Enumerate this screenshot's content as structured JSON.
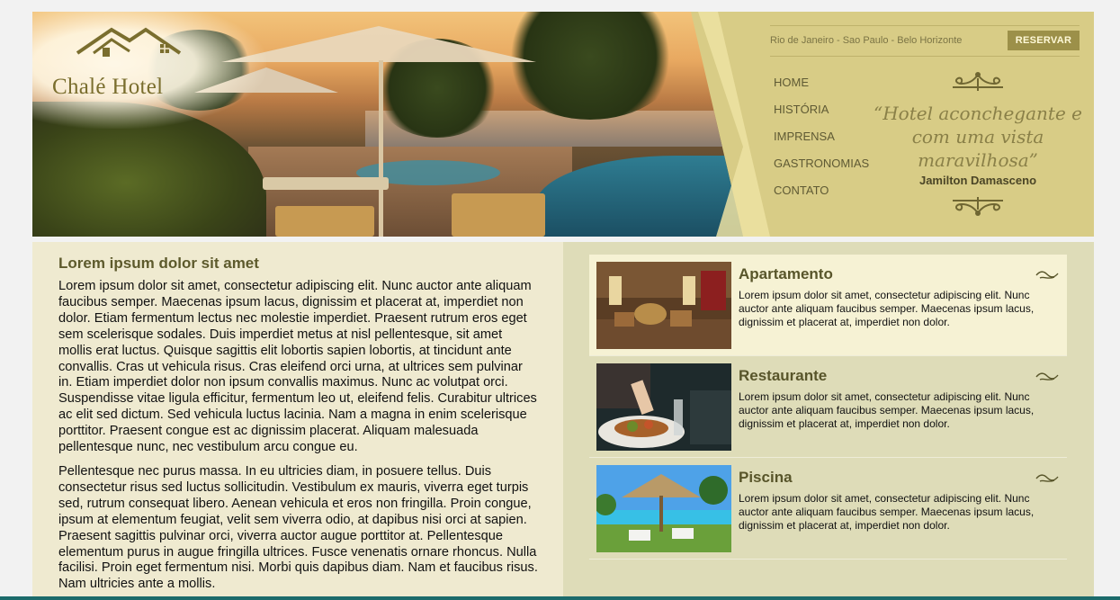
{
  "brand": {
    "name": "Chalé Hotel"
  },
  "header": {
    "cities": "Rio de Janeiro - Sao Paulo - Belo Horizonte",
    "reserve_label": "RESERVAR",
    "nav": [
      "HOME",
      "HISTÓRIA",
      "IMPRENSA",
      "GASTRONOMIAS",
      "CONTATO"
    ],
    "quote": "“Hotel aconchegante e com uma vista maravilhosa”",
    "quote_author": "Jamilton Damasceno"
  },
  "main": {
    "title": "Lorem ipsum dolor sit amet",
    "paragraphs": [
      "Lorem ipsum dolor sit amet, consectetur adipiscing elit. Nunc auctor ante aliquam faucibus semper. Maecenas ipsum lacus, dignissim et placerat at, imperdiet non dolor. Etiam fermentum lectus nec molestie imperdiet. Praesent rutrum eros eget sem scelerisque sodales. Duis imperdiet metus at nisl pellentesque, sit amet mollis erat luctus. Quisque sagittis elit lobortis sapien lobortis, at tincidunt ante convallis. Cras ut vehicula risus. Cras eleifend orci urna, at ultrices sem pulvinar in. Etiam imperdiet dolor non ipsum convallis maximus. Nunc ac volutpat orci. Suspendisse vitae ligula efficitur, fermentum leo ut, eleifend felis. Curabitur ultrices ac elit sed dictum. Sed vehicula luctus lacinia. Nam a magna in enim scelerisque porttitor. Praesent congue est ac dignissim placerat. Aliquam malesuada pellentesque nunc, nec vestibulum arcu congue eu.",
      "Pellentesque nec purus massa. In eu ultricies diam, in posuere tellus. Duis consectetur risus sed luctus sollicitudin. Vestibulum ex mauris, viverra eget turpis sed, rutrum consequat libero. Aenean vehicula et eros non fringilla. Proin congue, ipsum at elementum feugiat, velit sem viverra odio, at dapibus nisi orci at sapien. Praesent sagittis pulvinar orci, viverra auctor augue porttitor at. Pellentesque elementum purus in augue fringilla ultrices. Fusce venenatis ornare rhoncus. Nulla facilisi. Proin eget fermentum nisi. Morbi quis dapibus diam. Nam et faucibus risus. Nam ultricies ante a mollis."
    ]
  },
  "features": [
    {
      "title": "Apartamento",
      "text": "Lorem ipsum dolor sit amet, consectetur adipiscing elit. Nunc auctor ante aliquam faucibus semper. Maecenas ipsum lacus, dignissim et placerat at, imperdiet non dolor.",
      "active": true
    },
    {
      "title": "Restaurante",
      "text": "Lorem ipsum dolor sit amet, consectetur adipiscing elit. Nunc auctor ante aliquam faucibus semper. Maecenas ipsum lacus, dignissim et placerat at, imperdiet non dolor.",
      "active": false
    },
    {
      "title": "Piscina",
      "text": "Lorem ipsum dolor sit amet, consectetur adipiscing elit. Nunc auctor ante aliquam faucibus semper. Maecenas ipsum lacus, dignissim et placerat at, imperdiet non dolor.",
      "active": false
    }
  ],
  "colors": {
    "header_gold": "#d8cc86",
    "accent": "#9c9049",
    "heading": "#5d5a2c",
    "panel_light": "#efead0",
    "panel_active": "#f6f2d4"
  },
  "icons": [
    "house-roof-icon",
    "flourish-ornament-icon",
    "wave-ornament-icon"
  ]
}
